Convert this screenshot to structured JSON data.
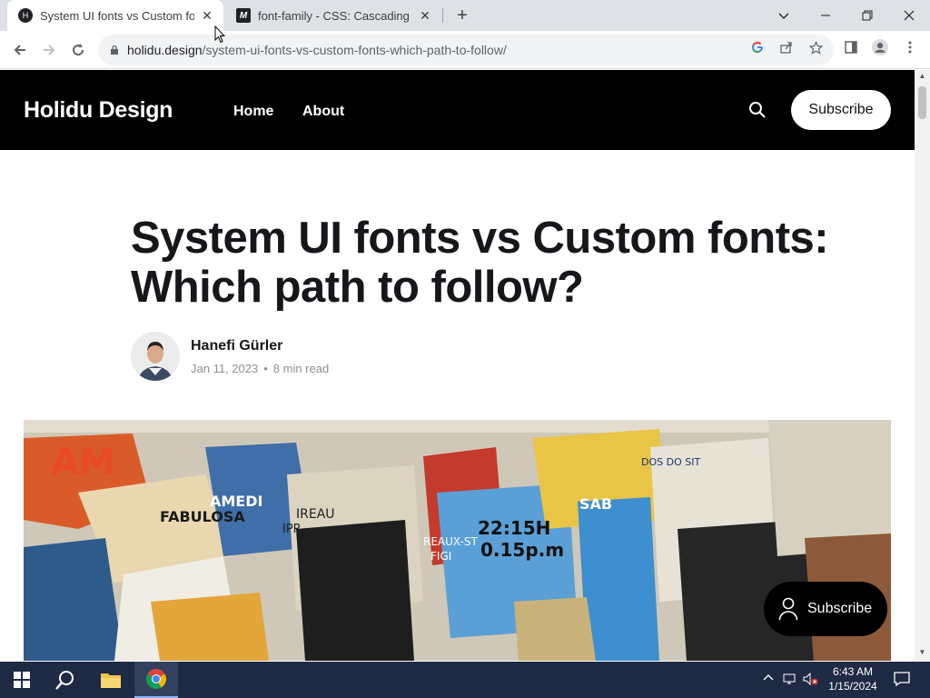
{
  "browser": {
    "tabs": [
      {
        "title": "System UI fonts vs Custom fon",
        "favicon": "holidu-icon",
        "active": true
      },
      {
        "title": "font-family - CSS: Cascading S",
        "favicon": "mdn-icon",
        "active": false
      }
    ],
    "new_tab": "+",
    "window_controls": [
      "chevron-down",
      "minimize",
      "restore",
      "close"
    ],
    "url_host": "holidu.design",
    "url_path": "/system-ui-fonts-vs-custom-fonts-which-path-to-follow/"
  },
  "site": {
    "logo": "Holidu Design",
    "nav": [
      "Home",
      "About"
    ],
    "subscribe": "Subscribe"
  },
  "article": {
    "title": "System UI fonts vs Custom fonts: Which path to follow?",
    "author": "Hanefi Gürler",
    "date": "Jan 11, 2023",
    "dot": "•",
    "read_time": "8 min read"
  },
  "hero_text": [
    "AM",
    "FABULOSA",
    "22:15H",
    "0.15p.m",
    "AMEDI",
    "SAB",
    "IREAU",
    "IPR",
    "REAUX-ST",
    "FIGI",
    "DOS DO SIT"
  ],
  "floating_subscribe": "Subscribe",
  "taskbar": {
    "time": "6:43 AM",
    "date": "1/15/2024"
  },
  "colors": {
    "header_bg": "#000000",
    "accent": "#15171a",
    "taskbar": "#1f2a44"
  }
}
